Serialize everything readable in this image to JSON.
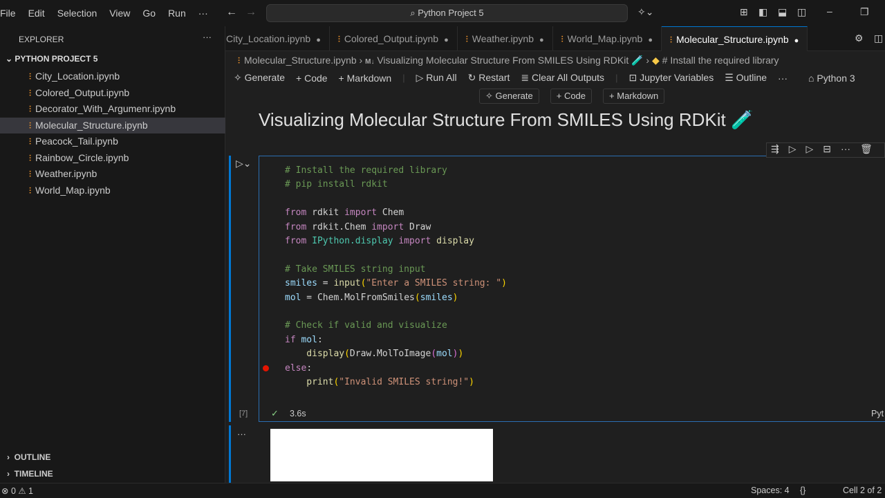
{
  "menu": [
    "File",
    "Edit",
    "Selection",
    "View",
    "Go",
    "Run",
    "···"
  ],
  "search": "Python Project 5",
  "sidebar": {
    "title": "EXPLORER",
    "project": "PYTHON PROJECT 5",
    "files": [
      "City_Location.ipynb",
      "Colored_Output.ipynb",
      "Decorator_With_Argumenr.ipynb",
      "Molecular_Structure.ipynb",
      "Peacock_Tail.ipynb",
      "Rainbow_Circle.ipynb",
      "Weather.ipynb",
      "World_Map.ipynb"
    ],
    "selected": 3,
    "outline": "OUTLINE",
    "timeline": "TIMELINE"
  },
  "tabs": [
    "City_Location.ipynb",
    "Colored_Output.ipynb",
    "Weather.ipynb",
    "World_Map.ipynb",
    "Molecular_Structure.ipynb"
  ],
  "breadcrumb": {
    "file": "Molecular_Structure.ipynb",
    "md_badge": "M↓",
    "heading": "Visualizing Molecular Structure From SMILES Using RDKit 🧪",
    "cell": "# Install the required library"
  },
  "toolbar": {
    "generate": "Generate",
    "code": "Code",
    "markdown": "Markdown",
    "run_all": "Run All",
    "restart": "Restart",
    "clear": "Clear All Outputs",
    "variables": "Jupyter Variables",
    "outline": "Outline",
    "more": "···",
    "kernel": "Python 3"
  },
  "insert": {
    "generate": "Generate",
    "code": "Code",
    "markdown": "Markdown"
  },
  "heading": "Visualizing Molecular Structure From SMILES Using RDKit 🧪",
  "cell": {
    "exec_count": "[7]",
    "duration": "3.6s",
    "lang": "Pyt",
    "lines": [
      [
        [
          "# Install the required library",
          "c"
        ]
      ],
      [
        [
          "# pip install rdkit",
          "c"
        ]
      ],
      [],
      [
        [
          "from",
          "k"
        ],
        [
          " rdkit ",
          "d"
        ],
        [
          "import",
          "k"
        ],
        [
          " Chem",
          "d"
        ]
      ],
      [
        [
          "from",
          "k"
        ],
        [
          " rdkit.Chem ",
          "d"
        ],
        [
          "import",
          "k"
        ],
        [
          " Draw",
          "d"
        ]
      ],
      [
        [
          "from",
          "k"
        ],
        [
          " ",
          "d"
        ],
        [
          "IPython.display",
          "m"
        ],
        [
          " ",
          "d"
        ],
        [
          "import",
          "k"
        ],
        [
          " ",
          "d"
        ],
        [
          "display",
          "f"
        ]
      ],
      [],
      [
        [
          "# Take SMILES string input",
          "c"
        ]
      ],
      [
        [
          "smiles",
          "v"
        ],
        [
          " = ",
          "d"
        ],
        [
          "input",
          "f"
        ],
        [
          "(",
          "b"
        ],
        [
          "\"Enter a SMILES string: \"",
          "s"
        ],
        [
          ")",
          "b"
        ]
      ],
      [
        [
          "mol",
          "v"
        ],
        [
          " = ",
          "d"
        ],
        [
          "Chem.MolFromSmiles",
          "d"
        ],
        [
          "(",
          "b"
        ],
        [
          "smiles",
          "v"
        ],
        [
          ")",
          "b"
        ]
      ],
      [],
      [
        [
          "# Check if valid and visualize",
          "c"
        ]
      ],
      [
        [
          "if",
          "k"
        ],
        [
          " ",
          "d"
        ],
        [
          "mol",
          "v"
        ],
        [
          ":",
          "d"
        ]
      ],
      [
        [
          "    display",
          "f"
        ],
        [
          "(",
          "b"
        ],
        [
          "Draw.MolToImage",
          "d"
        ],
        [
          "(",
          "p"
        ],
        [
          "mol",
          "v"
        ],
        [
          ")",
          "p"
        ],
        [
          ")",
          "b"
        ]
      ],
      [
        [
          "else",
          "k"
        ],
        [
          ":",
          "d"
        ]
      ],
      [
        [
          "    print",
          "f"
        ],
        [
          "(",
          "b"
        ],
        [
          "\"Invalid SMILES string!\"",
          "s"
        ],
        [
          ")",
          "b"
        ]
      ]
    ]
  },
  "status": {
    "problems": "⊗ 0 ⚠ 1",
    "spaces": "Spaces: 4",
    "braces": "{}",
    "cell": "Cell 2 of 2"
  }
}
